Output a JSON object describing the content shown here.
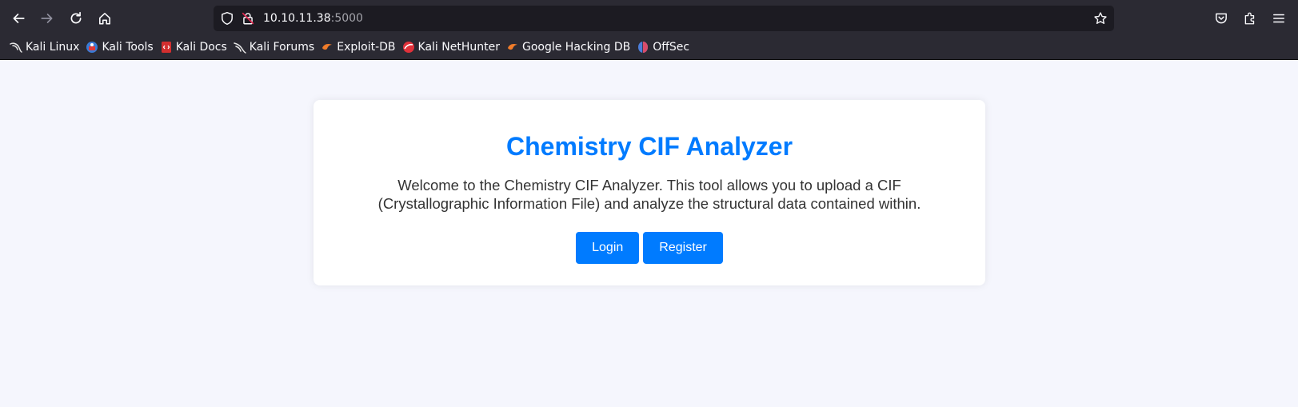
{
  "browser": {
    "url_host": "10.10.11.38",
    "url_port": ":5000",
    "bookmarks": [
      {
        "label": "Kali Linux",
        "icon": "kali-dragon-icon",
        "color": "#e8e8e8"
      },
      {
        "label": "Kali Tools",
        "icon": "kali-tools-icon",
        "color": "#3a7bd5"
      },
      {
        "label": "Kali Docs",
        "icon": "kali-docs-icon",
        "color": "#d32f2f"
      },
      {
        "label": "Kali Forums",
        "icon": "kali-forums-icon",
        "color": "#e8e8e8"
      },
      {
        "label": "Exploit-DB",
        "icon": "exploit-db-icon",
        "color": "#f07c2a"
      },
      {
        "label": "Kali NetHunter",
        "icon": "nethunter-icon",
        "color": "#e0313a"
      },
      {
        "label": "Google Hacking DB",
        "icon": "ghdb-icon",
        "color": "#f07c2a"
      },
      {
        "label": "OffSec",
        "icon": "offsec-icon",
        "color": "#4c7dd9"
      }
    ]
  },
  "main": {
    "title": "Chemistry CIF Analyzer",
    "description": "Welcome to the Chemistry CIF Analyzer. This tool allows you to upload a CIF (Crystallographic Information File) and analyze the structural data contained within.",
    "login_label": "Login",
    "register_label": "Register"
  },
  "colors": {
    "accent": "#007bff",
    "page_bg": "#f5f6fd",
    "chrome_bg": "#2b2a33"
  }
}
